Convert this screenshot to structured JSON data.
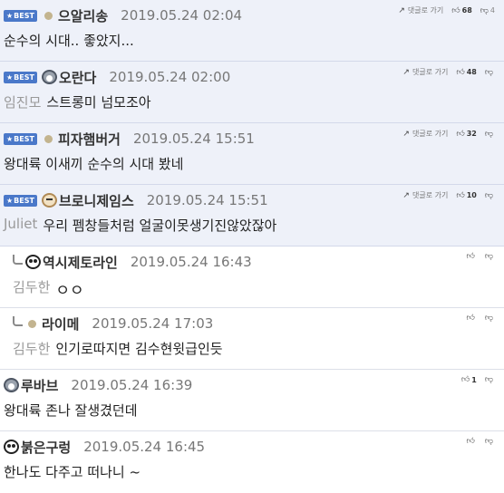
{
  "comments": [
    {
      "type": "best",
      "badge": "BEST",
      "avatar": "level-dot",
      "nickname": "으알리송",
      "date": "2019.05.24 02:04",
      "mention": "",
      "text": "순수의 시대.. 좋았지...",
      "reply_label": "댓글로 가기",
      "likes": "68",
      "dislikes": "4"
    },
    {
      "type": "best",
      "badge": "BEST",
      "avatar": "husky-avatar",
      "nickname": "오란다",
      "date": "2019.05.24 02:00",
      "mention": "임진모",
      "text": "스트롱미 넘모조아",
      "reply_label": "댓글로 가기",
      "likes": "48",
      "dislikes": ""
    },
    {
      "type": "best",
      "badge": "BEST",
      "avatar": "level-dot",
      "nickname": "피자햄버거",
      "date": "2019.05.24 15:51",
      "mention": "",
      "text": "왕대륙 이새끼 순수의 시대 봤네",
      "reply_label": "댓글로 가기",
      "likes": "32",
      "dislikes": ""
    },
    {
      "type": "best",
      "badge": "BEST",
      "avatar": "puppy-avatar",
      "nickname": "브로니제임스",
      "date": "2019.05.24 15:51",
      "mention": "Juliet",
      "text": "우리 펨창들처럼 얼굴이못생기진않았잖아",
      "reply_label": "댓글로 가기",
      "likes": "10",
      "dislikes": ""
    },
    {
      "type": "reply",
      "avatar": "panda-avatar",
      "nickname": "역시제토라인",
      "date": "2019.05.24 16:43",
      "mention": "김두한",
      "text": "ㅇㅇ",
      "likes": "",
      "dislikes": ""
    },
    {
      "type": "reply",
      "avatar": "level-dot",
      "nickname": "라이메",
      "date": "2019.05.24 17:03",
      "mention": "김두한",
      "text": "인기로따지면 김수현윗급인듯",
      "likes": "",
      "dislikes": ""
    },
    {
      "type": "normal",
      "avatar": "husky-avatar",
      "nickname": "루바브",
      "date": "2019.05.24 16:39",
      "mention": "",
      "text": "왕대륙 존나 잘생겼던데",
      "likes": "1",
      "dislikes": ""
    },
    {
      "type": "normal",
      "avatar": "panda-avatar",
      "nickname": "붉은구렁",
      "date": "2019.05.24 16:45",
      "mention": "",
      "text": "한나도 다주고 떠나니 ~",
      "likes": "",
      "dislikes": ""
    }
  ],
  "icons": {
    "like": "thumbs-up-icon",
    "dislike": "thumbs-down-icon",
    "reply": "reply-arrow-icon"
  },
  "colors": {
    "best_bg": "#eef1f9",
    "badge": "#4a78c9"
  }
}
